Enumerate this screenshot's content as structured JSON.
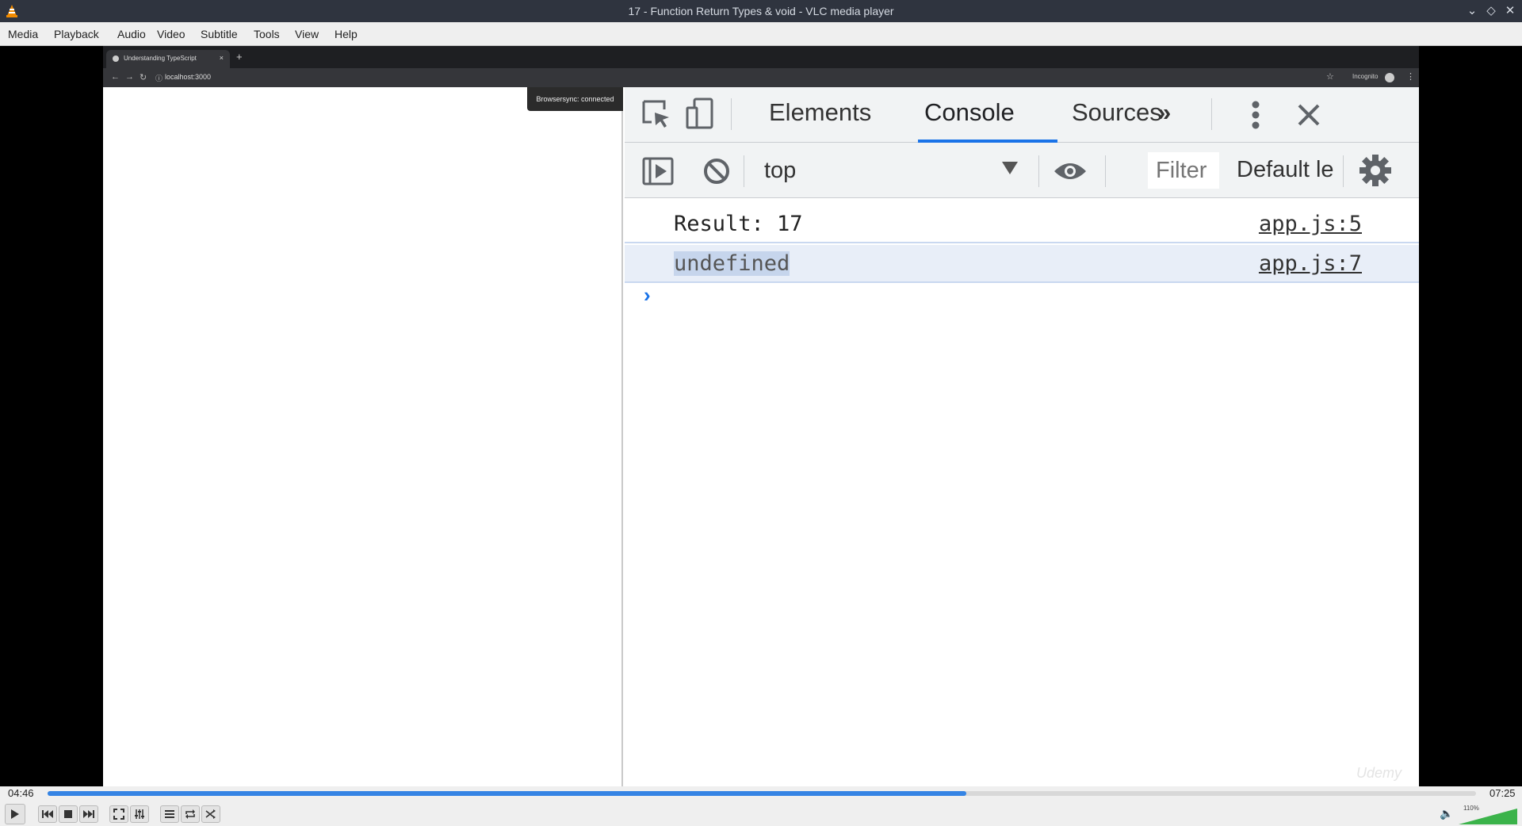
{
  "window": {
    "title": "17 - Function Return Types & void - VLC media player",
    "controls": [
      "minimize-icon",
      "maximize-icon",
      "close-icon"
    ]
  },
  "menu": [
    "Media",
    "Playback",
    "Audio",
    "Video",
    "Subtitle",
    "Tools",
    "View",
    "Help"
  ],
  "browser": {
    "tab_title": "Understanding TypeScript",
    "tab_close": "×",
    "new_tab": "+",
    "url": "localhost:3000",
    "incognito_label": "Incognito",
    "browsersync": "Browsersync: connected"
  },
  "devtools": {
    "tabs": [
      "Elements",
      "Console",
      "Sources",
      "»"
    ],
    "active_tab": "Console",
    "context": "top",
    "filter_placeholder": "Filter",
    "levels": "Default levels",
    "logs": [
      {
        "message": "Result: 17",
        "source": "app.js:5"
      },
      {
        "message": "undefined",
        "source": "app.js:7"
      }
    ],
    "prompt": "›"
  },
  "watermark": "Udemy",
  "player": {
    "elapsed": "04:46",
    "total": "07:25",
    "progress_fraction": 0.643,
    "volume_label": "110%",
    "volume_fraction": 1.0
  }
}
